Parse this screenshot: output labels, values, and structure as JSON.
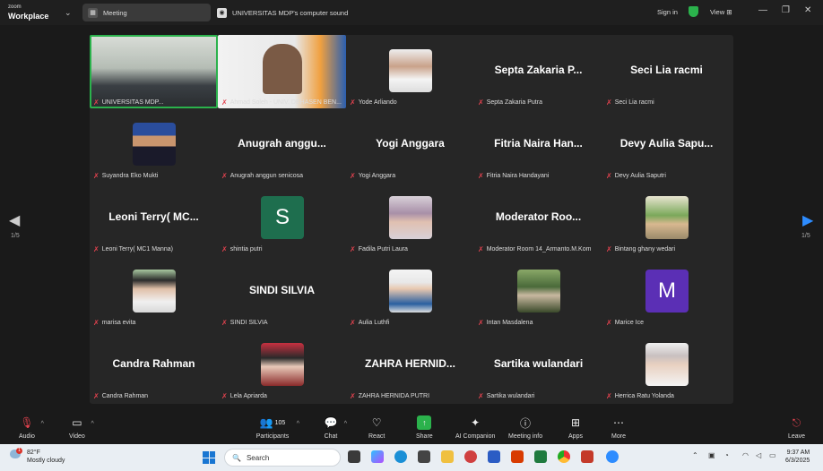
{
  "app": {
    "logo_line1": "zoom",
    "logo_line2": "Workplace"
  },
  "tabs": [
    {
      "label": "Meeting"
    },
    {
      "label": "UNIVERSITAS MDP's computer sound"
    }
  ],
  "header": {
    "signin": "Sign in",
    "view": "View"
  },
  "participants": [
    {
      "label": "UNIVERSITAS MDP..."
    },
    {
      "label": "Ahmad Soleh - UNIV. DEHASEN BEN..."
    },
    {
      "label": "Yode Arliando"
    },
    {
      "label": "Septa Zakaria Putra",
      "big": "Septa Zakaria P..."
    },
    {
      "label": "Seci Lia racmi",
      "big": "Seci Lia racmi"
    },
    {
      "label": "Suyandra Eko Mukti"
    },
    {
      "label": "Anugrah anggun senicosa",
      "big": "Anugrah anggu..."
    },
    {
      "label": "Yogi Anggara",
      "big": "Yogi Anggara"
    },
    {
      "label": "Fitria Naira Handayani",
      "big": "Fitria Naira Han..."
    },
    {
      "label": "Devy Aulia Saputri",
      "big": "Devy Aulia Sapu..."
    },
    {
      "label": "Leoni Terry( MC1 Manna)",
      "big": "Leoni Terry( MC..."
    },
    {
      "label": "shintia putri",
      "letter": "S"
    },
    {
      "label": "Fadila Putri Laura"
    },
    {
      "label": "Moderator Room 14_Armanto.M.Kom",
      "big": "Moderator Roo..."
    },
    {
      "label": "Bintang ghany wedari"
    },
    {
      "label": "marisa evita"
    },
    {
      "label": "SINDI SILVIA",
      "big": "SINDI SILVIA"
    },
    {
      "label": "Aulia Luthfi"
    },
    {
      "label": "Intan Masdalena"
    },
    {
      "label": "Marice Ice",
      "letter": "M"
    },
    {
      "label": "Candra Rahman",
      "big": "Candra Rahman"
    },
    {
      "label": "Lela Apriarda"
    },
    {
      "label": "ZAHRA HERNIDA PUTRI",
      "big": "ZAHRA HERNID..."
    },
    {
      "label": "Sartika wulandari",
      "big": "Sartika wulandari"
    },
    {
      "label": "Herrica Ratu Yolanda"
    }
  ],
  "pagination": {
    "left": "1/5",
    "right": "1/5"
  },
  "toolbar": {
    "audio": "Audio",
    "video": "Video",
    "participants": "Participants",
    "participants_count": "105",
    "chat": "Chat",
    "react": "React",
    "share": "Share",
    "ai": "AI Companion",
    "info": "Meeting info",
    "apps": "Apps",
    "more": "More",
    "leave": "Leave"
  },
  "taskbar": {
    "temp": "82°F",
    "weather": "Mostly cloudy",
    "search_placeholder": "Search",
    "time": "9:37 AM",
    "date": "6/3/2025",
    "badge": "1"
  },
  "colors": {
    "accent_green": "#2bb24c",
    "mute_red": "#e2424e",
    "letter_s": "#1e6e4e",
    "letter_m": "#5b2fb5"
  }
}
